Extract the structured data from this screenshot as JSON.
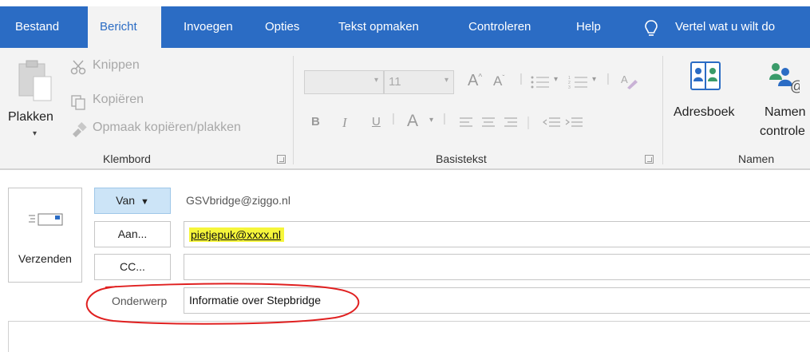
{
  "tabs": [
    {
      "label": "Bestand"
    },
    {
      "label": "Bericht"
    },
    {
      "label": "Invoegen"
    },
    {
      "label": "Opties"
    },
    {
      "label": "Tekst opmaken"
    },
    {
      "label": "Controleren"
    },
    {
      "label": "Help"
    }
  ],
  "active_tab": "Bericht",
  "tell_me": "Vertel wat u wilt do",
  "clipboard": {
    "paste": "Plakken",
    "cut": "Knippen",
    "copy": "Kopiëren",
    "format_painter": "Opmaak kopiëren/plakken",
    "group_label": "Klembord"
  },
  "basic_text": {
    "font_size": "11",
    "bold": "B",
    "italic": "I",
    "underline": "U",
    "font_color": "A",
    "group_label": "Basistekst"
  },
  "names": {
    "address_book": "Adresboek",
    "check_names_line1": "Namen",
    "check_names_line2": "controle",
    "group_label": "Namen"
  },
  "compose": {
    "send": "Verzenden",
    "from_button": "Van",
    "from_value": "GSVbridge@ziggo.nl",
    "to_button": "Aan...",
    "to_value": "pietjepuk@xxxx.nl",
    "cc_button": "CC...",
    "cc_value": "",
    "subject_label": "Onderwerp",
    "subject_value": "Informatie over Stepbridge"
  },
  "colors": {
    "tab_bar": "#2b6cc4",
    "ribbon": "#f3f3f3",
    "highlight": "#f6f63a",
    "annotation": "#e02020"
  }
}
